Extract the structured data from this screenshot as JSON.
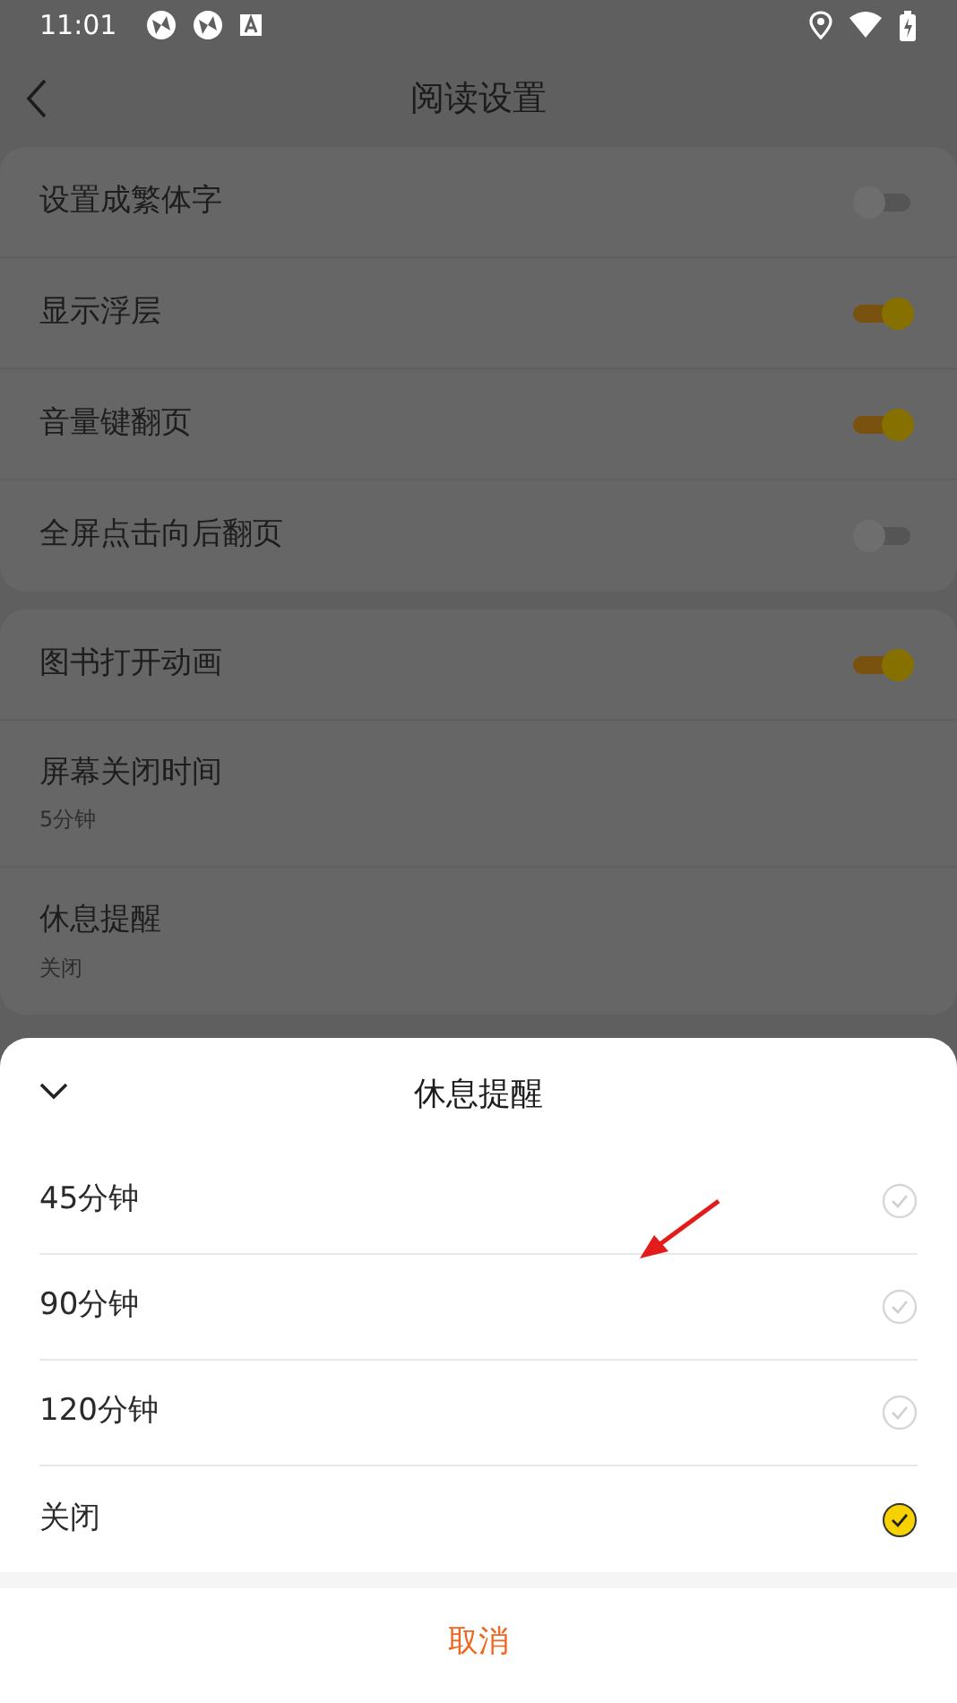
{
  "status_bar": {
    "time": "11:01"
  },
  "header": {
    "title": "阅读设置"
  },
  "groups": [
    {
      "items": [
        {
          "kind": "toggle",
          "label": "设置成繁体字",
          "on": false
        },
        {
          "kind": "toggle",
          "label": "显示浮层",
          "on": true
        },
        {
          "kind": "toggle",
          "label": "音量键翻页",
          "on": true
        },
        {
          "kind": "toggle",
          "label": "全屏点击向后翻页",
          "on": false
        }
      ]
    },
    {
      "items": [
        {
          "kind": "toggle",
          "label": "图书打开动画",
          "on": true
        },
        {
          "kind": "value",
          "label": "屏幕关闭时间",
          "value": "5分钟"
        },
        {
          "kind": "value",
          "label": "休息提醒",
          "value": "关闭"
        }
      ]
    }
  ],
  "sheet": {
    "title": "休息提醒",
    "options": [
      {
        "label": "45分钟",
        "selected": false
      },
      {
        "label": "90分钟",
        "selected": false
      },
      {
        "label": "120分钟",
        "selected": false
      },
      {
        "label": "关闭",
        "selected": true
      }
    ],
    "cancel": "取消"
  }
}
